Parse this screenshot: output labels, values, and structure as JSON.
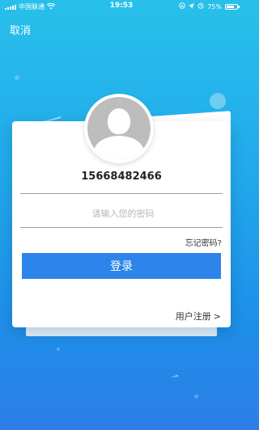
{
  "status_bar": {
    "carrier": "中国联通",
    "time": "19:53",
    "battery_percent": "75%",
    "battery_level": 0.75,
    "icons": [
      "signal-icon",
      "wifi-icon",
      "lock-rotation-icon",
      "location-icon",
      "alarm-icon",
      "battery-icon"
    ]
  },
  "header": {
    "cancel_label": "取消"
  },
  "login": {
    "phone": "15668482466",
    "password_placeholder": "请输入您的密码",
    "forgot_label": "忘记密码?",
    "login_button": "登录",
    "register_label": "用户注册",
    "register_chevron": ">"
  },
  "colors": {
    "background_top": "#28c0ea",
    "background_bottom": "#2c7ee6",
    "button": "#2d84ea"
  }
}
